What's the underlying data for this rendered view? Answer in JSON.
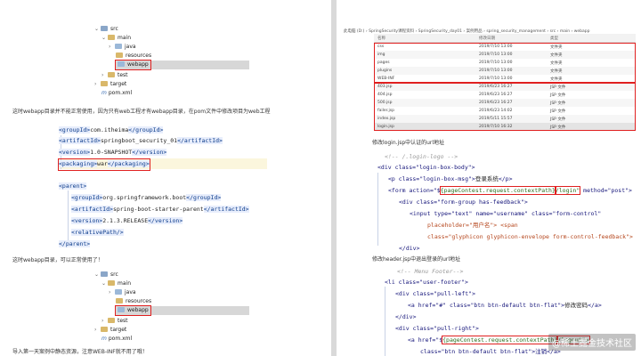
{
  "left": {
    "tree1": {
      "src": "src",
      "main": "main",
      "java": "java",
      "resources": "resources",
      "webapp": "webapp",
      "test": "test",
      "target": "target",
      "pom": "pom.xml"
    },
    "para1": "这时webapp目录并不能正常使用，因为只有web工程才有webapp目录，在pom文件中修改项目为web工程",
    "xml": {
      "groupId_open": "<groupId>",
      "groupId_val": "com.itheima",
      "groupId_close": "</groupId>",
      "artifactId_open": "<artifactId>",
      "artifactId_val": "springboot_security_01",
      "artifactId_close": "</artifactId>",
      "version_open": "<version>",
      "version_val": "1.0-SNAPSHOT",
      "version_close": "</version>",
      "packaging_open": "<packaging>",
      "packaging_val": "war",
      "packaging_close": "</packaging>",
      "parent_open": "<parent>",
      "p_groupId_open": "<groupId>",
      "p_groupId_val": "org.springframework.boot",
      "p_groupId_close": "</groupId>",
      "p_artifactId_open": "<artifactId>",
      "p_artifactId_val": "spring-boot-starter-parent",
      "p_artifactId_close": "</artifactId>",
      "p_version_open": "<version>",
      "p_version_val": "2.1.3.RELEASE",
      "p_version_close": "</version>",
      "relativePath": "<relativePath/>",
      "parent_close": "</parent>"
    },
    "para2": "这时webapp目录，可以正常使用了！",
    "tree2": {
      "src": "src",
      "main": "main",
      "java": "java",
      "resources": "resources",
      "webapp": "webapp",
      "test": "test",
      "target": "target",
      "pom": "pom.xml"
    },
    "para3": "导入第一天案例中静态资源，注意WEB-INF就不用了哦！"
  },
  "right": {
    "path": "此电脑 (D:)  ›  SpringSecurity课程资料  ›  SpringSecurity_day01  ›  案例用品  ›  spring_security_management  ›  src  ›  main  ›  webapp",
    "headers": [
      "名称",
      "修改日期",
      "类型"
    ],
    "files": [
      [
        "css",
        "2019/7/10 13:00",
        "文件夹"
      ],
      [
        "img",
        "2019/7/10 13:00",
        "文件夹"
      ],
      [
        "pages",
        "2019/7/10 13:00",
        "文件夹"
      ],
      [
        "plugins",
        "2019/7/10 13:00",
        "文件夹"
      ],
      [
        "WEB-INF",
        "2019/7/10 13:00",
        "文件夹"
      ],
      [
        "403.jsp",
        "2019/6/23 16:27",
        "JSP 文件"
      ],
      [
        "404.jsp",
        "2019/6/23 16:27",
        "JSP 文件"
      ],
      [
        "500.jsp",
        "2019/6/23 16:27",
        "JSP 文件"
      ],
      [
        "failer.jsp",
        "2019/6/23 14:02",
        "JSP 文件"
      ],
      [
        "index.jsp",
        "2019/5/11 15:57",
        "JSP 文件"
      ],
      [
        "login.jsp",
        "2019/7/10 16:32",
        "JSP 文件"
      ]
    ],
    "para1": "修改login.jsp中认证的url地址",
    "login": {
      "comment": "<!-- /.login-logo -->",
      "l1": "<div class=\"login-box-body\">",
      "l2a": "<p class=\"login-box-msg\">",
      "l2b": "登录系统",
      "l2c": "</p>",
      "l3a": "<form action=\"$",
      "l3b": "{pageContest.request.contextPath}",
      "l3c": "/login\"",
      "l3d": " method=\"post\">",
      "l4": "<div class=\"form-group has-feedback\">",
      "l5a": "<input type=\"text\" name=\"username\" class=\"form-control\"",
      "l6": "placeholder=\"用户名\"> <span",
      "l7": "class=\"glyphicon glyphicon-envelope form-control-feedback\">",
      "l8": "</div>"
    },
    "para2": "修改header.jsp中退出登录的url地址",
    "header": {
      "comment": "<!-- Menu Footer-->",
      "l1": "<li class=\"user-footer\">",
      "l2": "<div class=\"pull-left\">",
      "l3a": "<a href=\"#\" class=\"btn btn-default btn-flat\">",
      "l3b": "修改密码",
      "l3c": "</a>",
      "l4": "</div>",
      "l5": "<div class=\"pull-right\">",
      "l6a": "<a href=\"$",
      "l6b": "{pageContest.request.contextPath}",
      "l6c": "/logout\">",
      "l7": "class=\"btn btn-default btn-flat\">注销</a>"
    },
    "watermark": "@稀土掘金技术社区"
  }
}
